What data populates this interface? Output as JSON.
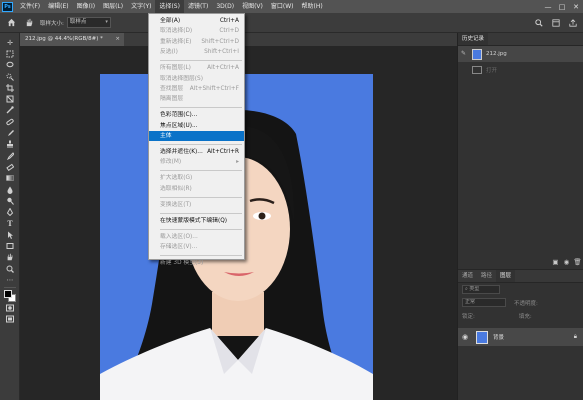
{
  "menubar": {
    "logo": "Ps",
    "items": [
      "文件(F)",
      "编辑(E)",
      "图像(I)",
      "图层(L)",
      "文字(Y)",
      "选择(S)",
      "滤镜(T)",
      "3D(D)",
      "视图(V)",
      "窗口(W)",
      "帮助(H)"
    ],
    "active_index": 5,
    "window_controls": [
      "—",
      "□",
      "✕"
    ]
  },
  "options": {
    "home_icon": "home-icon",
    "tool_icon": "hand-icon",
    "sample_size_label": "取样大小:",
    "sample_size_value": "取样点"
  },
  "document": {
    "tab_title": "212.jpg @ 44.4%(RGB/8#) *",
    "close": "×"
  },
  "select_menu": {
    "items": [
      {
        "label": "全部(A)",
        "shortcut": "Ctrl+A",
        "disabled": false
      },
      {
        "label": "取消选择(D)",
        "shortcut": "Ctrl+D",
        "disabled": true
      },
      {
        "label": "重新选择(E)",
        "shortcut": "Shift+Ctrl+D",
        "disabled": true
      },
      {
        "label": "反选(I)",
        "shortcut": "Shift+Ctrl+I",
        "disabled": true
      },
      {
        "sep": true
      },
      {
        "label": "所有图层(L)",
        "shortcut": "Alt+Ctrl+A",
        "disabled": true
      },
      {
        "label": "取消选择图层(S)",
        "shortcut": "",
        "disabled": true
      },
      {
        "label": "查找图层",
        "shortcut": "Alt+Shift+Ctrl+F",
        "disabled": true
      },
      {
        "label": "隔离图层",
        "shortcut": "",
        "disabled": true
      },
      {
        "sep": true
      },
      {
        "label": "色彩范围(C)...",
        "shortcut": "",
        "disabled": false
      },
      {
        "label": "焦点区域(U)...",
        "shortcut": "",
        "disabled": false
      },
      {
        "label": "主体",
        "shortcut": "",
        "disabled": false,
        "highlight": true
      },
      {
        "sep": true
      },
      {
        "label": "选择并遮住(K)...",
        "shortcut": "Alt+Ctrl+R",
        "disabled": false
      },
      {
        "label": "修改(M)",
        "shortcut": "▸",
        "disabled": true
      },
      {
        "sep": true
      },
      {
        "label": "扩大选取(G)",
        "shortcut": "",
        "disabled": true
      },
      {
        "label": "选取相似(R)",
        "shortcut": "",
        "disabled": true
      },
      {
        "sep": true
      },
      {
        "label": "变换选区(T)",
        "shortcut": "",
        "disabled": true
      },
      {
        "sep": true
      },
      {
        "label": "在快速蒙版模式下编辑(Q)",
        "shortcut": "",
        "disabled": false
      },
      {
        "sep": true
      },
      {
        "label": "载入选区(O)...",
        "shortcut": "",
        "disabled": true
      },
      {
        "label": "存储选区(V)...",
        "shortcut": "",
        "disabled": true
      },
      {
        "sep": true
      },
      {
        "label": "新建 3D 模型(3)",
        "shortcut": "",
        "disabled": true
      }
    ]
  },
  "history_panel": {
    "tab": "历史记录",
    "entries": [
      {
        "label": "212.jpg",
        "selected": true
      },
      {
        "label": "打开",
        "selected": false
      }
    ]
  },
  "layers_panel": {
    "tabs": [
      "通道",
      "路径",
      "图层"
    ],
    "active_tab": 2,
    "kind_label": "类型",
    "blend_mode": "正常",
    "opacity_label": "不透明度:",
    "lock_label": "锁定:",
    "fill_label": "填充:",
    "layer_name": "背景"
  },
  "colors": {
    "photo_background": "#4a7ae0",
    "menu_highlight": "#0a72c8"
  }
}
